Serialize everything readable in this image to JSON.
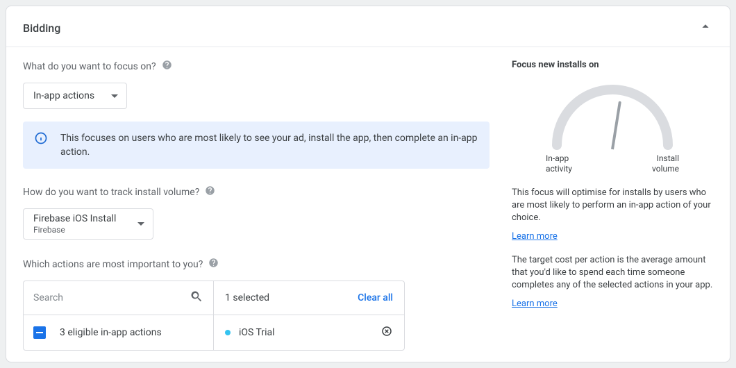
{
  "header": {
    "title": "Bidding"
  },
  "focus": {
    "question": "What do you want to focus on?",
    "selected": "In-app actions",
    "banner": "This focuses on users who are most likely to see your ad, install the app, then complete an in-app action."
  },
  "track": {
    "question": "How do you want to track install volume?",
    "selected": "Firebase iOS Install",
    "sub": "Firebase"
  },
  "actions": {
    "question": "Which actions are most important to you?",
    "search_placeholder": "Search",
    "selected_label": "1 selected",
    "clear_label": "Clear all",
    "eligible_label": "3 eligible in-app actions",
    "selected_item": "iOS Trial"
  },
  "side": {
    "title": "Focus new installs on",
    "gauge_left": "In-app activity",
    "gauge_right": "Install volume",
    "para1": "This focus will optimise for installs by users who are most likely to perform an in-app action of your choice.",
    "learn1": "Learn more",
    "para2": "The target cost per action is the average amount that you'd like to spend each time someone completes any of the selected actions in your app.",
    "learn2": "Learn more"
  }
}
